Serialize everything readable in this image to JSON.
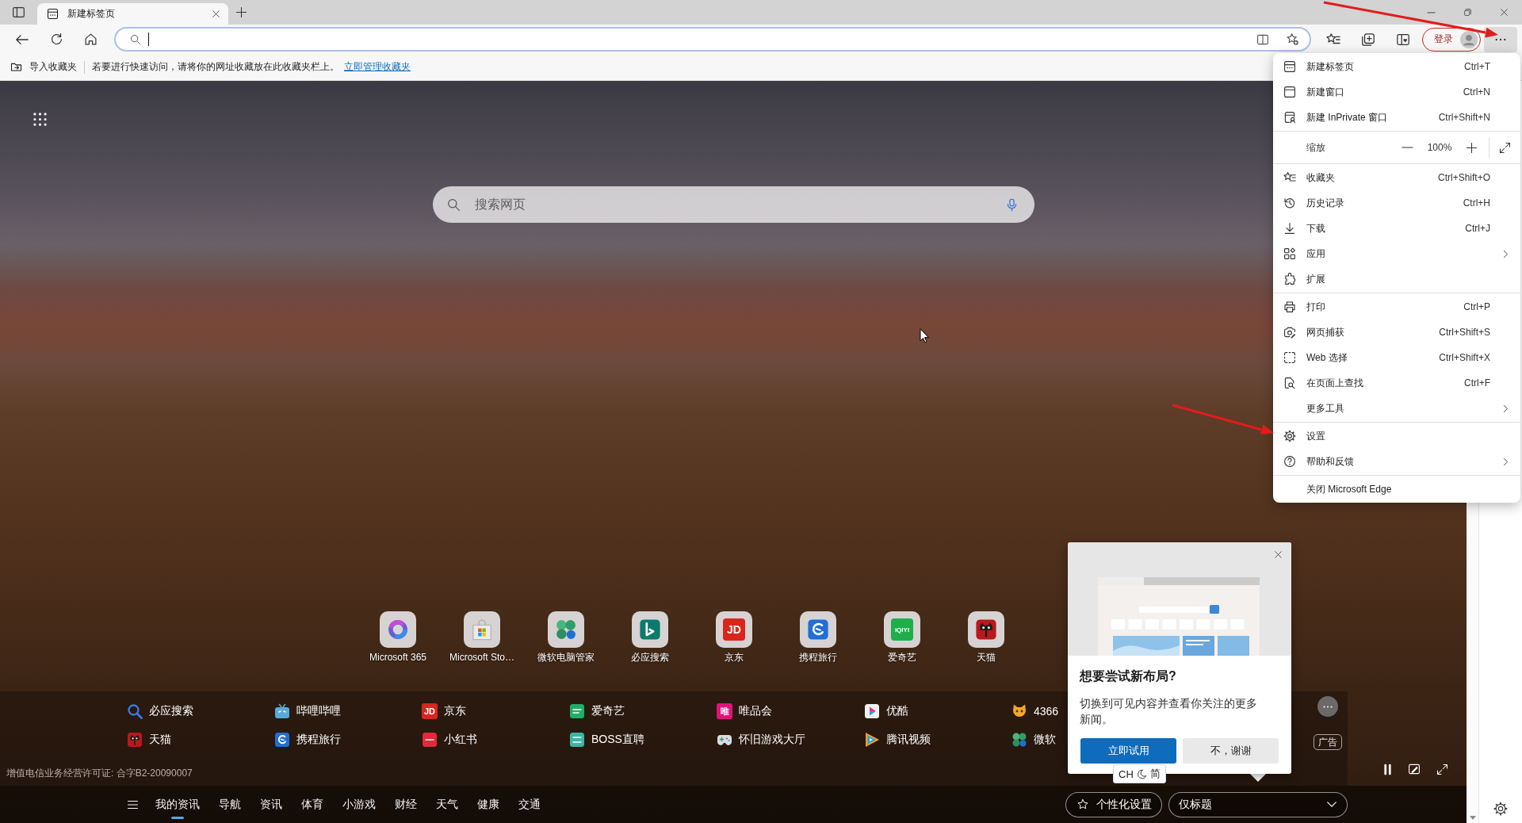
{
  "tabs": [
    {
      "title": "新建标签页",
      "selected": true
    }
  ],
  "address_bar": {
    "focused": true
  },
  "account_button": {
    "label": "登录"
  },
  "menu": {
    "open": true,
    "items": [
      {
        "kind": "item",
        "label": "新建标签页",
        "shortcut": "Ctrl+T"
      },
      {
        "kind": "item",
        "label": "新建窗口",
        "shortcut": "Ctrl+N"
      },
      {
        "kind": "item",
        "label": "新建 InPrivate 窗口",
        "shortcut": "Ctrl+Shift+N"
      },
      {
        "kind": "separator"
      },
      {
        "kind": "zoom",
        "label": "缩放",
        "value": "100%"
      },
      {
        "kind": "separator"
      },
      {
        "kind": "item",
        "label": "收藏夹",
        "shortcut": "Ctrl+Shift+O"
      },
      {
        "kind": "item",
        "label": "历史记录",
        "shortcut": "Ctrl+H"
      },
      {
        "kind": "item",
        "label": "下载",
        "shortcut": "Ctrl+J"
      },
      {
        "kind": "submenu",
        "label": "应用"
      },
      {
        "kind": "item",
        "label": "扩展"
      },
      {
        "kind": "separator"
      },
      {
        "kind": "item",
        "label": "打印",
        "shortcut": "Ctrl+P"
      },
      {
        "kind": "item",
        "label": "网页捕获",
        "shortcut": "Ctrl+Shift+S"
      },
      {
        "kind": "item",
        "label": "Web 选择",
        "shortcut": "Ctrl+Shift+X"
      },
      {
        "kind": "item",
        "label": "在页面上查找",
        "shortcut": "Ctrl+F"
      },
      {
        "kind": "submenu",
        "label": "更多工具"
      },
      {
        "kind": "separator"
      },
      {
        "kind": "item",
        "label": "设置"
      },
      {
        "kind": "submenu",
        "label": "帮助和反馈"
      },
      {
        "kind": "separator"
      },
      {
        "kind": "item",
        "label": "关闭 Microsoft Edge"
      }
    ]
  },
  "favorites_bar": {
    "import_button": "导入收藏夹",
    "hint": "若要进行快速访问，请将你的网址收藏放在此收藏夹栏上。",
    "manage_link": "立即管理收藏夹"
  },
  "search": {
    "placeholder": "搜索网页"
  },
  "quick_links": [
    {
      "label": "Microsoft 365"
    },
    {
      "label": "Microsoft Sto…"
    },
    {
      "label": "微软电脑管家"
    },
    {
      "label": "必应搜索"
    },
    {
      "label": "京东",
      "logo": "JD"
    },
    {
      "label": "携程旅行"
    },
    {
      "label": "爱奇艺",
      "logo": "iQIYI"
    },
    {
      "label": "天猫"
    }
  ],
  "top_sites": [
    {
      "label": "必应搜索"
    },
    {
      "label": "哔哩哔哩"
    },
    {
      "label": "京东",
      "logo": "JD"
    },
    {
      "label": "爱奇艺"
    },
    {
      "label": "唯品会",
      "logo": "唯"
    },
    {
      "label": "优酷"
    },
    {
      "label": "4366"
    },
    {
      "label": "天猫"
    },
    {
      "label": "携程旅行"
    },
    {
      "label": "小红书"
    },
    {
      "label": "BOSS直聘"
    },
    {
      "label": "怀旧游戏大厅"
    },
    {
      "label": "腾讯视频"
    },
    {
      "label": "微软"
    }
  ],
  "ad_label": "广告",
  "license": "增值电信业务经营许可证: 合字B2-20090007",
  "feed_nav": {
    "items": [
      {
        "label": "我的资讯",
        "selected": true
      },
      {
        "label": "导航",
        "selected": false
      },
      {
        "label": "资讯",
        "selected": false
      },
      {
        "label": "体育",
        "selected": false
      },
      {
        "label": "小游戏",
        "selected": false
      },
      {
        "label": "财经",
        "selected": false
      },
      {
        "label": "天气",
        "selected": false
      },
      {
        "label": "健康",
        "selected": false
      },
      {
        "label": "交通",
        "selected": false
      }
    ]
  },
  "personalize_button": "个性化设置",
  "layout_select": {
    "value": "仅标题"
  },
  "popup": {
    "title": "想要尝试新布局?",
    "body": "切换到可见内容并查看你关注的更多新闻。",
    "buttons": [
      {
        "label": "立即试用",
        "kind": "primary"
      },
      {
        "label": "不，谢谢",
        "kind": "secondary"
      }
    ]
  },
  "ime_indicator": {
    "language": "CH",
    "mode": "简"
  }
}
